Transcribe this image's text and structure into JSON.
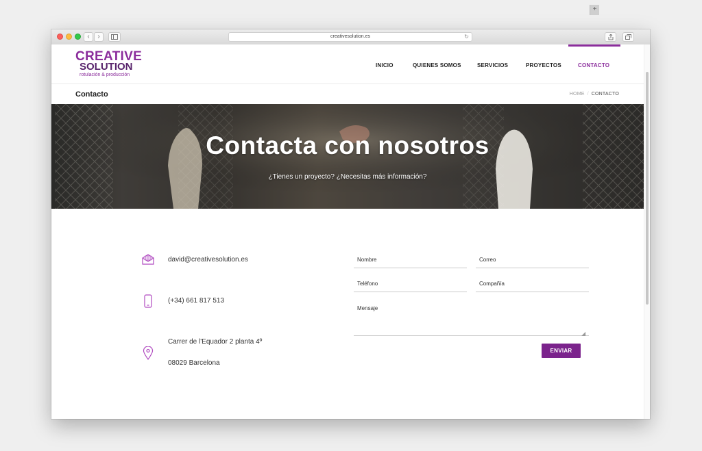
{
  "browser": {
    "url": "creativesolution.es",
    "back_icon": "‹",
    "forward_icon": "›"
  },
  "logo": {
    "line1": "CREATIVE",
    "line2": "SOLUTION",
    "tagline": "rotulación & producción"
  },
  "nav": {
    "items": [
      {
        "label": "INICIO",
        "active": false
      },
      {
        "label": "QUIENES SOMOS",
        "active": false
      },
      {
        "label": "SERVICIOS",
        "active": false
      },
      {
        "label": "PROYECTOS",
        "active": false
      },
      {
        "label": "CONTACTO",
        "active": true
      }
    ]
  },
  "page_title": "Contacto",
  "breadcrumb": {
    "home": "HOME",
    "separator": "/",
    "current": "CONTACTO"
  },
  "hero": {
    "title": "Contacta con nosotros",
    "subtitle": "¿Tienes un proyecto? ¿Necesitas más información?"
  },
  "contact": {
    "email": "david@creativesolution.es",
    "phone": "(+34) 661 817 513",
    "address_line1": "Carrer de l'Equador 2 planta 4º",
    "address_line2": "08029 Barcelona"
  },
  "form": {
    "nombre": "Nombre",
    "correo": "Correo",
    "telefono": "Teléfono",
    "compania": "Compañía",
    "mensaje": "Mensaje",
    "submit": "ENVIAR"
  },
  "colors": {
    "accent": "#8b2d9c",
    "button": "#7b238c"
  }
}
